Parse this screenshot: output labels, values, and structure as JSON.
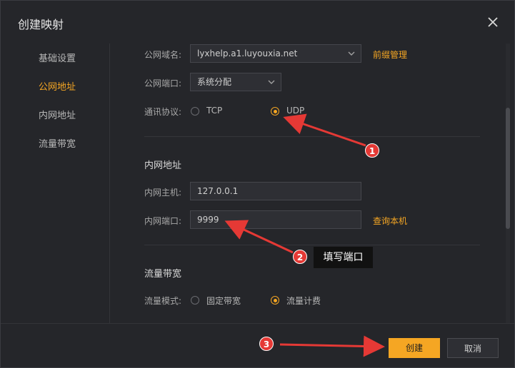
{
  "dialog": {
    "title": "创建映射"
  },
  "sidebar": {
    "items": [
      {
        "label": "基础设置"
      },
      {
        "label": "公网地址"
      },
      {
        "label": "内网地址"
      },
      {
        "label": "流量带宽"
      }
    ]
  },
  "public": {
    "domain_label": "公网域名:",
    "domain_value": "lyxhelp.a1.luyouxia.net",
    "domain_link": "前缀管理",
    "port_label": "公网端口:",
    "port_value": "系统分配",
    "protocol_label": "通讯协议:",
    "protocols": [
      {
        "label": "TCP",
        "selected": false
      },
      {
        "label": "UDP",
        "selected": true
      }
    ]
  },
  "internal": {
    "section_title": "内网地址",
    "host_label": "内网主机:",
    "host_value": "127.0.0.1",
    "port_label": "内网端口:",
    "port_value": "9999",
    "port_link": "查询本机"
  },
  "bandwidth": {
    "section_title": "流量带宽",
    "mode_label": "流量模式:",
    "modes": [
      {
        "label": "固定带宽",
        "selected": false
      },
      {
        "label": "流量计费",
        "selected": true
      }
    ]
  },
  "footer": {
    "create_label": "创建",
    "cancel_label": "取消"
  },
  "annotations": {
    "badge1": "1",
    "badge2": "2",
    "badge3": "3",
    "tip": "填写端口"
  },
  "colors": {
    "accent": "#f5a623",
    "annotation": "#e53935"
  }
}
